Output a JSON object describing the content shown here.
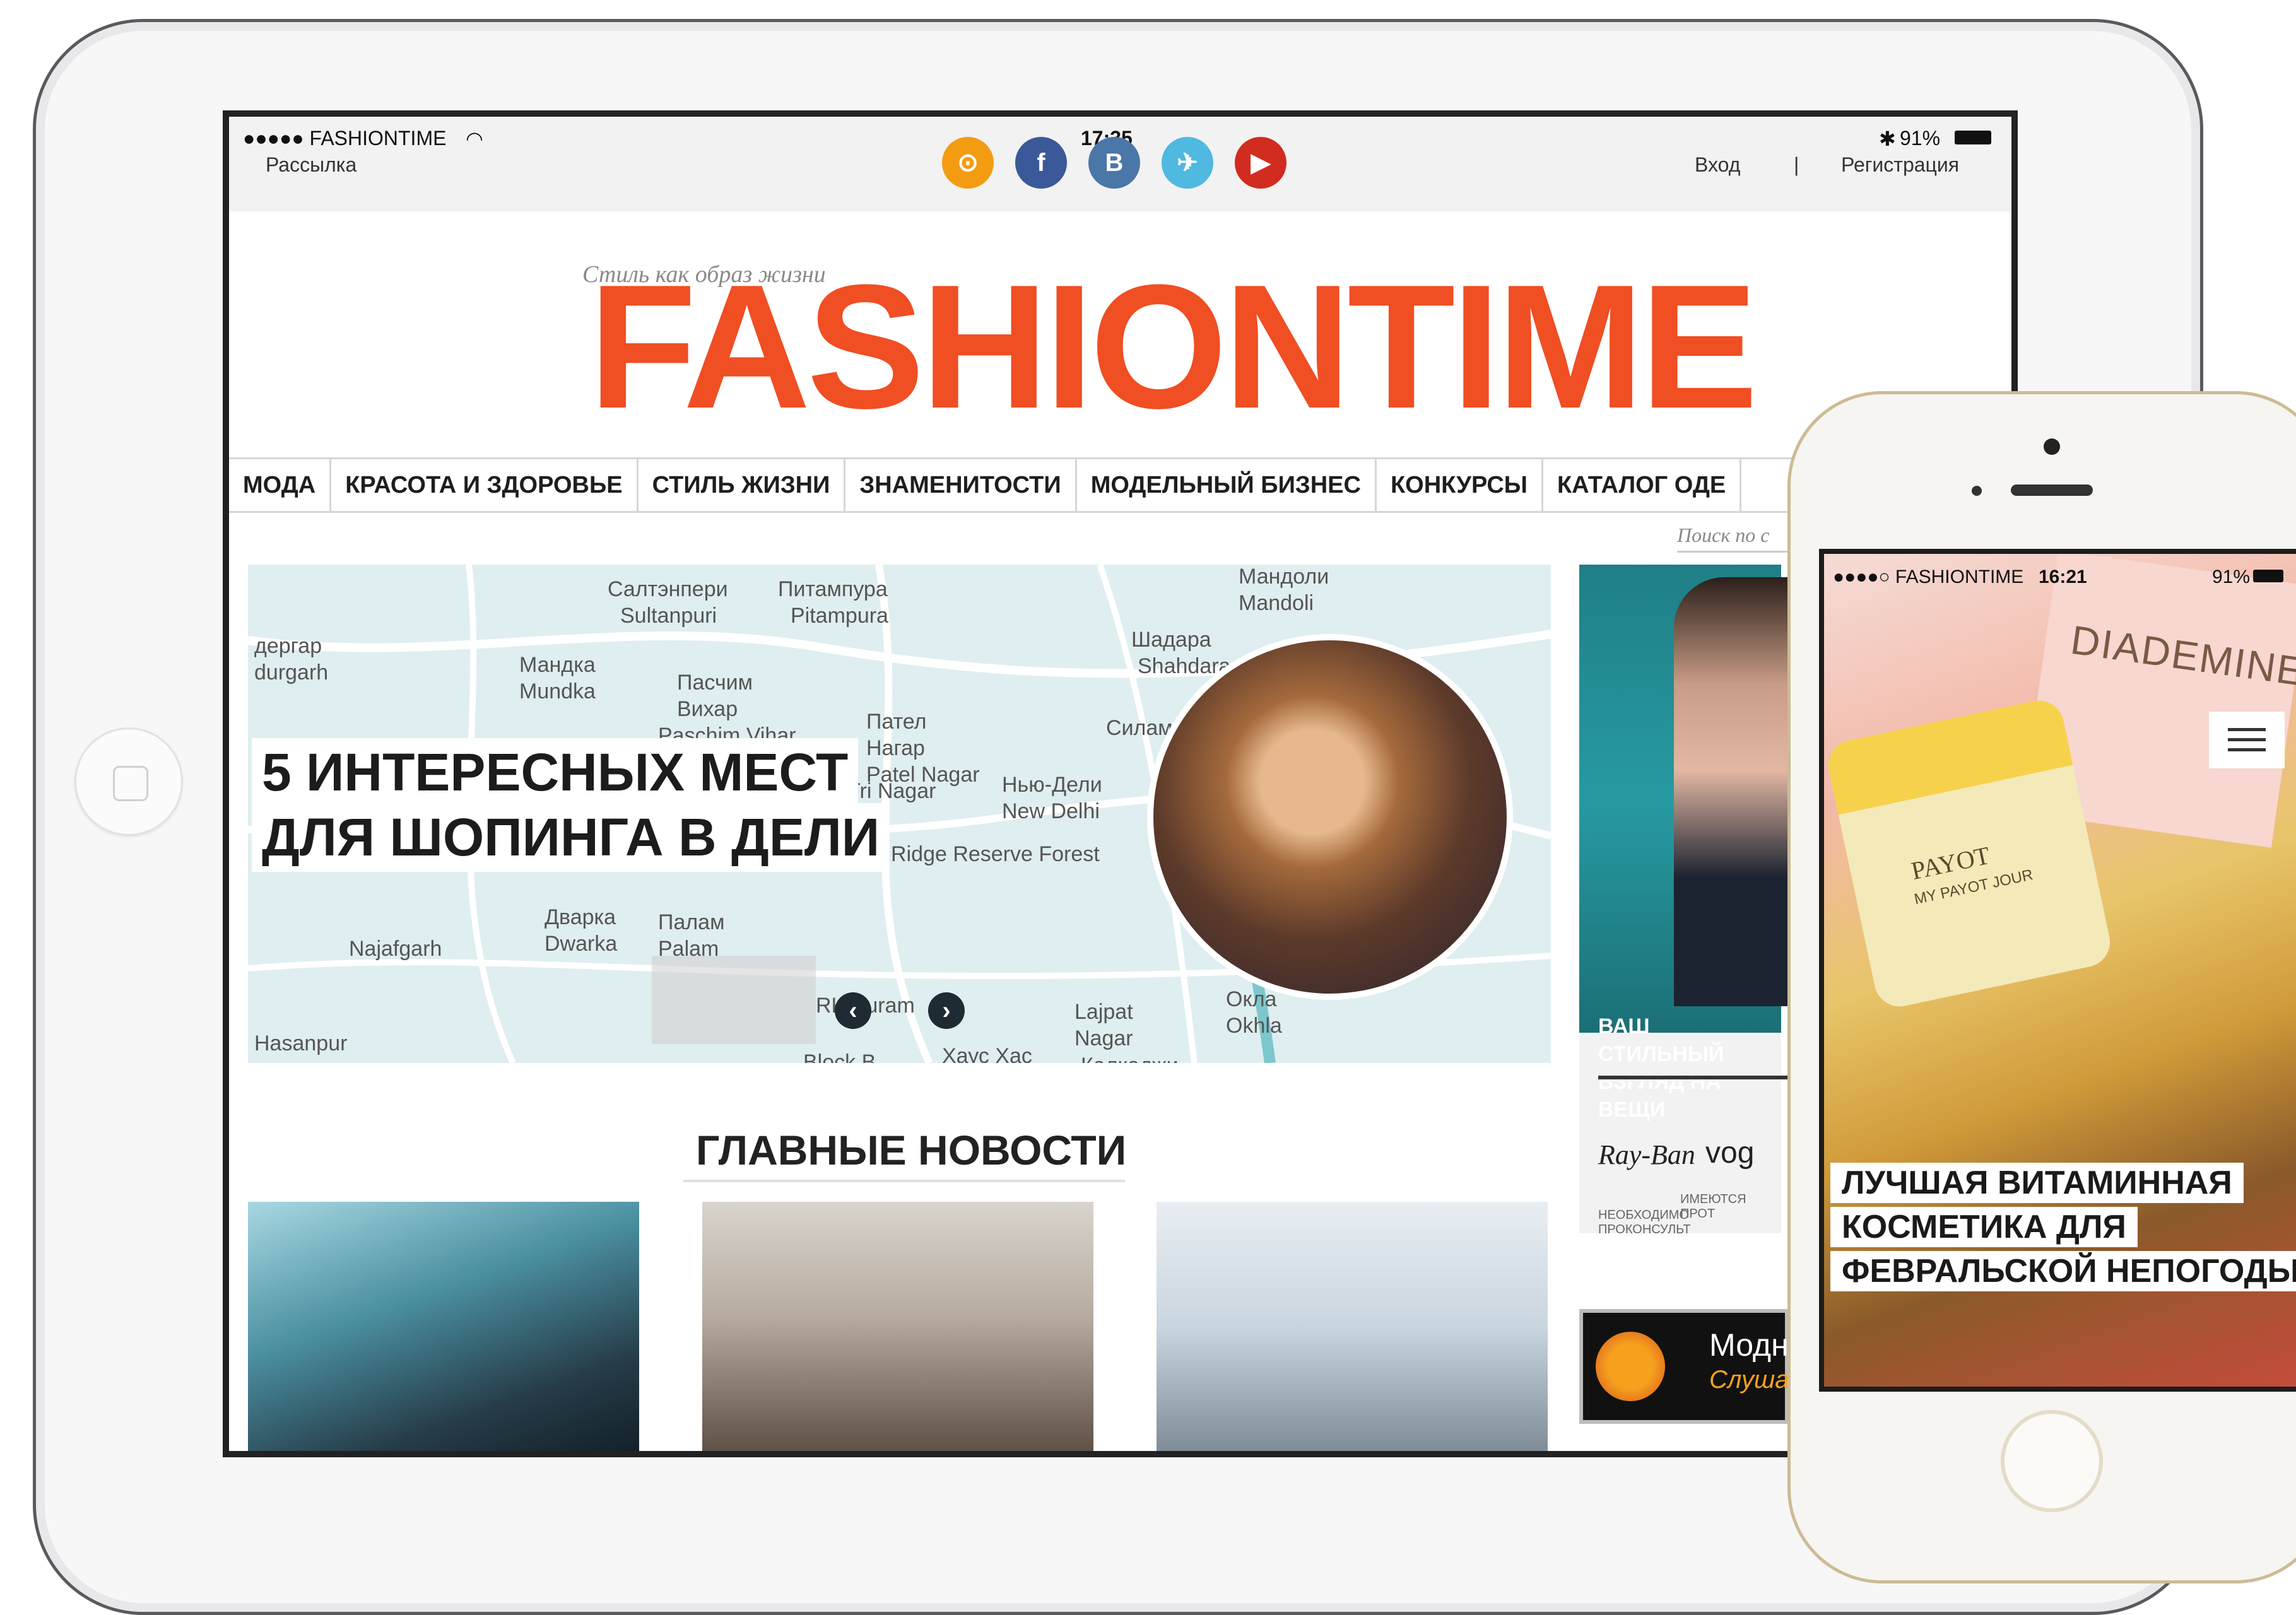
{
  "tablet": {
    "status": {
      "carrier": "●●●●● FASHIONTIME",
      "time": "17:35",
      "battery": "91%",
      "newsletter": "Рассылка",
      "login": "Вход",
      "divider": "|",
      "register": "Регистрация"
    },
    "social": [
      {
        "icon": "rss-icon",
        "glyph": "⊙",
        "color": "#f39c12"
      },
      {
        "icon": "facebook-icon",
        "glyph": "f",
        "color": "#3b5998"
      },
      {
        "icon": "vkontakte-icon",
        "glyph": "B",
        "color": "#4a76a8"
      },
      {
        "icon": "twitter-icon",
        "glyph": "✈",
        "color": "#4fb9e0"
      },
      {
        "icon": "youtube-icon",
        "glyph": "▶",
        "color": "#d12c1f"
      }
    ],
    "logo": {
      "tagline": "Стиль как образ жизни",
      "name": "FASHIONTIME"
    },
    "nav": [
      "МОДА",
      "КРАСОТА И ЗДОРОВЬЕ",
      "СТИЛЬ ЖИЗНИ",
      "ЗНАМЕНИТОСТИ",
      "МОДЕЛЬНЫЙ БИЗНЕС",
      "КОНКУРСЫ",
      "КАТАЛОГ ОДЕ"
    ],
    "search_placeholder": "Поиск по с",
    "hero": {
      "headline_line1": "5 ИНТЕРЕСНЫХ МЕСТ",
      "headline_line2": "ДЛЯ ШОПИНГА В ДЕЛИ",
      "map_labels": [
        "Салтэнпери",
        "Sultanpuri",
        "Питампура",
        "Pitampura",
        "Мандоли",
        "Mandoli",
        "Шадара",
        "Shahdara",
        "Мандка",
        "Mundka",
        "Пасчим",
        "Вихар",
        "Paschim Vihar",
        "Пател",
        "Нагар",
        "Patel Nagar",
        "Нью-Дели",
        "New Delhi",
        "Tri Nagar",
        "Дварка",
        "Dwarka",
        "Палам",
        "Palam",
        "Najafgarh",
        "Hasanpur",
        "Lajpat",
        "Nagar",
        "Окла",
        "Okhla",
        "Хаус Хас",
        "Калкаджи",
        "дергар",
        "durgarh",
        "Силам",
        "Central Ridge Reserve Forest",
        "Block B",
        "RK Puram"
      ],
      "prev_label": "‹",
      "next_label": "›"
    },
    "news_title": "ГЛАВНЫЕ НОВОСТИ",
    "ad": {
      "slogan": "ВАШ СТИЛЬНЫЙ ВЗГЛЯД НА ВЕЩИ",
      "brand1": "Ray-Ban",
      "brand2": "vog",
      "fineprint1": "ИМЕЮТСЯ ПРОТ",
      "fineprint2": "НЕОБХОДИМО ПРОКОНСУЛЬТ"
    },
    "radio_banner": {
      "line1": "Модн",
      "line2": "Слуша"
    }
  },
  "phone": {
    "status": {
      "carrier": "●●●●○ FASHIONTIME",
      "time": "16:21",
      "battery": "91%"
    },
    "headline": [
      "ЛУЧШАЯ ВИТАМИННАЯ",
      "КОСМЕТИКА ДЛЯ",
      "ФЕВРАЛЬСКОЙ НЕПОГОДЫ"
    ],
    "products": [
      "DIADEMINE",
      "PAYOT",
      "MY PAYOT JOUR"
    ]
  }
}
